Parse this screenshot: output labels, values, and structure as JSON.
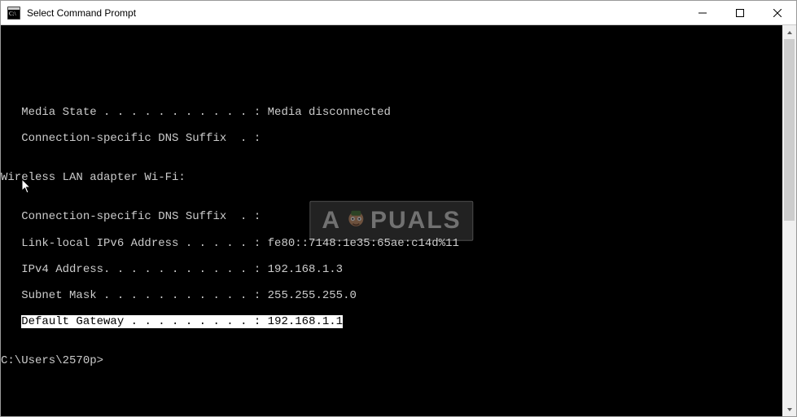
{
  "window": {
    "title": "Select Command Prompt"
  },
  "terminal": {
    "line1": "   Media State . . . . . . . . . . . : Media disconnected",
    "line2": "   Connection-specific DNS Suffix  . :",
    "blank1": "",
    "line3": "Wireless LAN adapter Wi-Fi:",
    "blank2": "",
    "line4": "   Connection-specific DNS Suffix  . :",
    "line5": "   Link-local IPv6 Address . . . . . : fe80::7148:1e35:65ae:c14d%11",
    "line6": "   IPv4 Address. . . . . . . . . . . : 192.168.1.3",
    "line7": "   Subnet Mask . . . . . . . . . . . : 255.255.255.0",
    "line8_pre": "   ",
    "line8_sel": "Default Gateway . . . . . . . . . : 192.168.1.1",
    "blank3": "",
    "prompt": "C:\\Users\\2570p>"
  },
  "watermark": {
    "pre": "A",
    "post": "PUALS"
  }
}
